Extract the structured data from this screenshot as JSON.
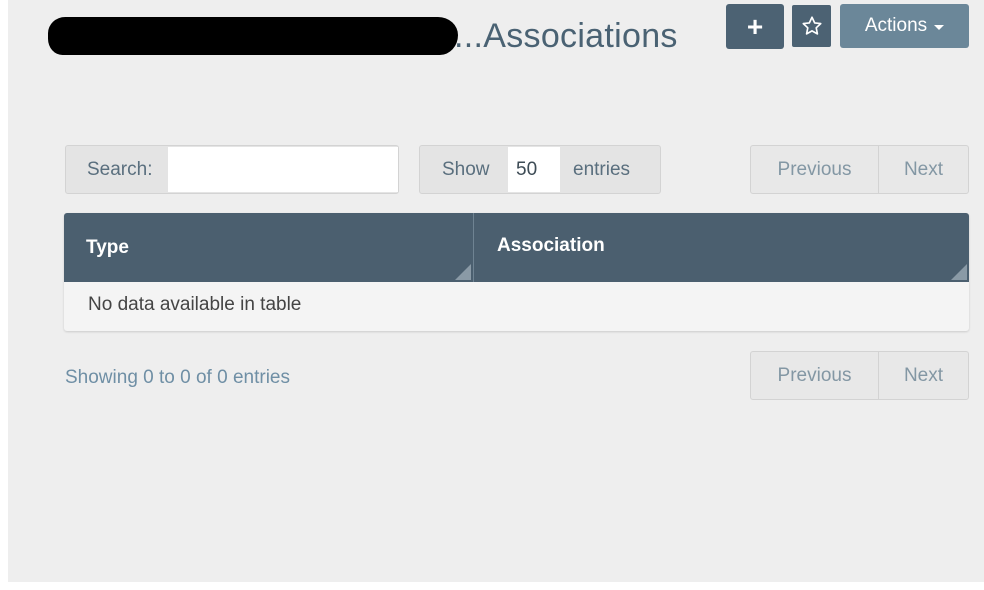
{
  "header": {
    "title": "...Associations",
    "add_label": "+",
    "star_label": "☆",
    "actions_label": "Actions"
  },
  "controls": {
    "search_label": "Search:",
    "search_value": "",
    "show_label": "Show",
    "length_value": "50",
    "entries_label": "entries",
    "prev_label": "Previous",
    "next_label": "Next"
  },
  "table": {
    "columns": [
      "Type",
      "Association"
    ],
    "empty_message": "No data available in table"
  },
  "footer": {
    "info": "Showing 0 to 0 of 0 entries",
    "prev_label": "Previous",
    "next_label": "Next"
  },
  "colors": {
    "header_bg": "#4b5f6f",
    "accent": "#4c6273",
    "actions_bg": "#6b8799",
    "panel_bg": "#eeeeee"
  }
}
